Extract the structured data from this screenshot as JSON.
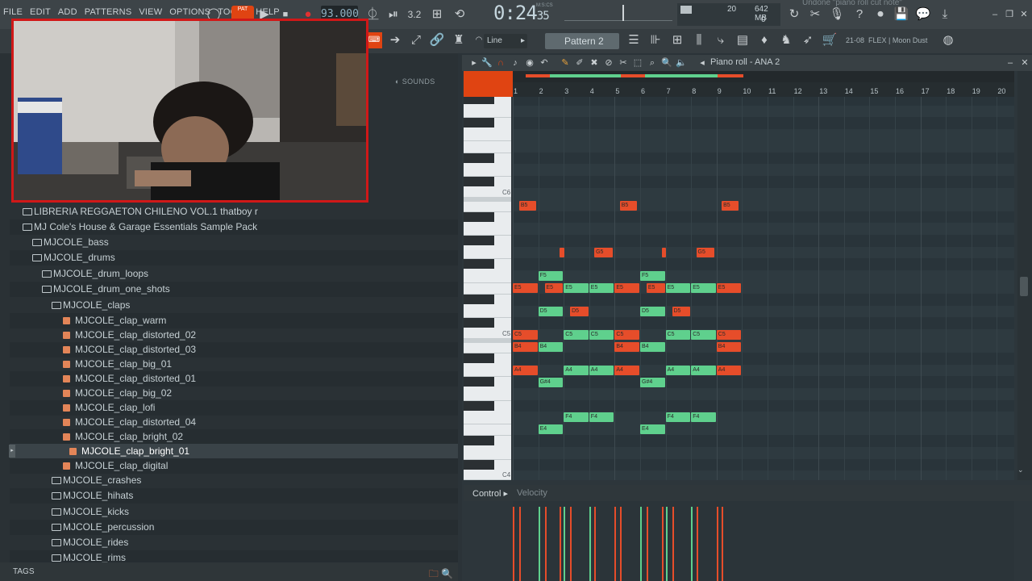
{
  "menu": [
    "FILE",
    "EDIT",
    "ADD",
    "PATTERNS",
    "VIEW",
    "OPTIONS",
    "TOOLS",
    "HELP"
  ],
  "transport": {
    "mode_label": "PAT",
    "tempo": "93.000",
    "time_main": "0:24",
    "time_small": "35",
    "time_unit": "M:S:CS"
  },
  "monitor": {
    "voices": "20",
    "memory": "642 MB",
    "cpu": "0"
  },
  "status_hint": "Undone \"piano roll cut note\"",
  "toolbar2": {
    "snap": "Line",
    "pattern": "Pattern 2",
    "preset_number": "21-08",
    "preset_name": "FLEX | Moon Dust"
  },
  "browser": {
    "sounds_tab": "SOUNDS",
    "tags_label": "TAGS",
    "items": [
      {
        "label": "LIBRERIA REGGAETON CHILENO VOL.1 thatboy r",
        "type": "folder"
      },
      {
        "label": "MJ Cole's House & Garage Essentials Sample Pack",
        "type": "folder"
      },
      {
        "label": "MJCOLE_bass",
        "type": "folder"
      },
      {
        "label": "MJCOLE_drums",
        "type": "folder"
      },
      {
        "label": "MJCOLE_drum_loops",
        "type": "folder"
      },
      {
        "label": "MJCOLE_drum_one_shots",
        "type": "folder"
      },
      {
        "label": "MJCOLE_claps",
        "type": "folder"
      },
      {
        "label": "MJCOLE_clap_warm",
        "type": "file"
      },
      {
        "label": "MJCOLE_clap_distorted_02",
        "type": "file"
      },
      {
        "label": "MJCOLE_clap_distorted_03",
        "type": "file"
      },
      {
        "label": "MJCOLE_clap_big_01",
        "type": "file"
      },
      {
        "label": "MJCOLE_clap_distorted_01",
        "type": "file"
      },
      {
        "label": "MJCOLE_clap_big_02",
        "type": "file"
      },
      {
        "label": "MJCOLE_clap_lofi",
        "type": "file"
      },
      {
        "label": "MJCOLE_clap_distorted_04",
        "type": "file"
      },
      {
        "label": "MJCOLE_clap_bright_02",
        "type": "file"
      },
      {
        "label": "MJCOLE_clap_bright_01",
        "type": "file",
        "selected": true
      },
      {
        "label": "MJCOLE_clap_digital",
        "type": "file"
      },
      {
        "label": "MJCOLE_crashes",
        "type": "folder"
      },
      {
        "label": "MJCOLE_hihats",
        "type": "folder"
      },
      {
        "label": "MJCOLE_kicks",
        "type": "folder"
      },
      {
        "label": "MJCOLE_percussion",
        "type": "folder"
      },
      {
        "label": "MJCOLE_rides",
        "type": "folder"
      },
      {
        "label": "MJCOLE_rims",
        "type": "folder"
      }
    ]
  },
  "piano_roll": {
    "title": "Piano roll - ANA 2",
    "bars": [
      "1",
      "2",
      "3",
      "4",
      "5",
      "6",
      "7",
      "8",
      "9",
      "10",
      "11",
      "12",
      "13",
      "14",
      "15",
      "16",
      "17",
      "18",
      "19",
      "20"
    ],
    "key_labels": [
      "C6",
      "C5",
      "C4"
    ],
    "notes": [
      {
        "pitch": "B5",
        "bar": 1.25,
        "len": 0.7,
        "color": "red"
      },
      {
        "pitch": "B5",
        "bar": 5.2,
        "len": 0.7,
        "color": "red"
      },
      {
        "pitch": "B5",
        "bar": 9.2,
        "len": 0.7,
        "color": "red"
      },
      {
        "pitch": "",
        "bar": 2.85,
        "len": 0.2,
        "color": "red",
        "row": "G5"
      },
      {
        "pitch": "G5",
        "bar": 4.2,
        "len": 0.75,
        "color": "red"
      },
      {
        "pitch": "",
        "bar": 6.85,
        "len": 0.2,
        "color": "red",
        "row": "G5"
      },
      {
        "pitch": "G5",
        "bar": 8.2,
        "len": 0.75,
        "color": "red"
      },
      {
        "pitch": "F5",
        "bar": 2.0,
        "len": 1.0,
        "color": "green"
      },
      {
        "pitch": "F5",
        "bar": 6.0,
        "len": 1.0,
        "color": "green"
      },
      {
        "pitch": "E5",
        "bar": 1.0,
        "len": 1.0,
        "color": "red"
      },
      {
        "pitch": "E5",
        "bar": 2.25,
        "len": 0.75,
        "color": "red"
      },
      {
        "pitch": "E5",
        "bar": 3.0,
        "len": 1.0,
        "color": "green"
      },
      {
        "pitch": "E5",
        "bar": 4.0,
        "len": 1.0,
        "color": "green"
      },
      {
        "pitch": "E5",
        "bar": 5.0,
        "len": 1.0,
        "color": "red"
      },
      {
        "pitch": "E5",
        "bar": 6.25,
        "len": 0.75,
        "color": "red"
      },
      {
        "pitch": "E5",
        "bar": 7.0,
        "len": 1.0,
        "color": "green"
      },
      {
        "pitch": "E5",
        "bar": 8.0,
        "len": 1.0,
        "color": "green"
      },
      {
        "pitch": "E5",
        "bar": 9.0,
        "len": 1.0,
        "color": "red"
      },
      {
        "pitch": "D5",
        "bar": 2.0,
        "len": 1.0,
        "color": "green"
      },
      {
        "pitch": "D5",
        "bar": 3.25,
        "len": 0.75,
        "color": "red"
      },
      {
        "pitch": "D5",
        "bar": 6.0,
        "len": 1.0,
        "color": "green"
      },
      {
        "pitch": "D5",
        "bar": 7.25,
        "len": 0.75,
        "color": "red"
      },
      {
        "pitch": "C5",
        "bar": 1.0,
        "len": 1.0,
        "color": "red"
      },
      {
        "pitch": "C5",
        "bar": 3.0,
        "len": 1.0,
        "color": "green"
      },
      {
        "pitch": "C5",
        "bar": 4.0,
        "len": 1.0,
        "color": "green"
      },
      {
        "pitch": "C5",
        "bar": 5.0,
        "len": 1.0,
        "color": "red"
      },
      {
        "pitch": "C5",
        "bar": 7.0,
        "len": 1.0,
        "color": "green"
      },
      {
        "pitch": "C5",
        "bar": 8.0,
        "len": 1.0,
        "color": "green"
      },
      {
        "pitch": "C5",
        "bar": 9.0,
        "len": 1.0,
        "color": "red"
      },
      {
        "pitch": "B4",
        "bar": 1.0,
        "len": 1.0,
        "color": "red"
      },
      {
        "pitch": "B4",
        "bar": 2.0,
        "len": 1.0,
        "color": "green"
      },
      {
        "pitch": "B4",
        "bar": 5.0,
        "len": 1.0,
        "color": "red"
      },
      {
        "pitch": "B4",
        "bar": 6.0,
        "len": 1.0,
        "color": "green"
      },
      {
        "pitch": "B4",
        "bar": 9.0,
        "len": 1.0,
        "color": "red"
      },
      {
        "pitch": "A4",
        "bar": 1.0,
        "len": 1.0,
        "color": "red"
      },
      {
        "pitch": "A4",
        "bar": 3.0,
        "len": 1.0,
        "color": "green"
      },
      {
        "pitch": "A4",
        "bar": 4.0,
        "len": 1.0,
        "color": "green"
      },
      {
        "pitch": "A4",
        "bar": 5.0,
        "len": 1.0,
        "color": "red"
      },
      {
        "pitch": "A4",
        "bar": 7.0,
        "len": 1.0,
        "color": "green"
      },
      {
        "pitch": "A4",
        "bar": 8.0,
        "len": 1.0,
        "color": "green"
      },
      {
        "pitch": "A4",
        "bar": 9.0,
        "len": 1.0,
        "color": "red"
      },
      {
        "pitch": "G#4",
        "bar": 2.0,
        "len": 1.0,
        "color": "green"
      },
      {
        "pitch": "G#4",
        "bar": 6.0,
        "len": 1.0,
        "color": "green"
      },
      {
        "pitch": "F4",
        "bar": 3.0,
        "len": 1.0,
        "color": "green"
      },
      {
        "pitch": "F4",
        "bar": 4.0,
        "len": 1.0,
        "color": "green"
      },
      {
        "pitch": "F4",
        "bar": 7.0,
        "len": 1.0,
        "color": "green"
      },
      {
        "pitch": "F4",
        "bar": 8.0,
        "len": 1.0,
        "color": "green"
      },
      {
        "pitch": "E4",
        "bar": 2.0,
        "len": 1.0,
        "color": "green"
      },
      {
        "pitch": "E4",
        "bar": 6.0,
        "len": 1.0,
        "color": "green"
      }
    ]
  },
  "control": {
    "label": "Control",
    "velocity_label": "Velocity"
  },
  "colors": {
    "accent": "#e04412",
    "note_red": "#e64d2a",
    "note_green": "#5fd08d",
    "webcam_border": "#d01818"
  }
}
